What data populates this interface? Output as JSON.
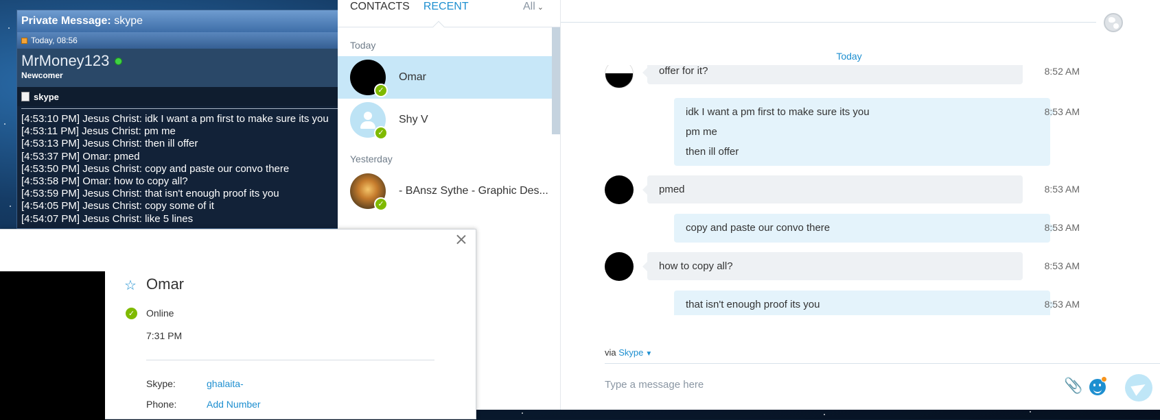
{
  "pm": {
    "title_prefix": "Private Message:",
    "title_subject": "skype",
    "date": "Today, 08:56",
    "username": "MrMoney123",
    "rank": "Newcomer",
    "subject": "skype",
    "lines": [
      "[4:53:10 PM] Jesus Christ: idk I want a pm first to make sure its you",
      "[4:53:11 PM] Jesus Christ: pm me",
      "[4:53:13 PM] Jesus Christ: then ill offer",
      "[4:53:37 PM] Omar: pmed",
      "[4:53:50 PM] Jesus Christ: copy and paste our convo there",
      "[4:53:58 PM] Omar: how to copy all?",
      "[4:53:59 PM] Jesus Christ: that isn't enough proof its you",
      "[4:54:05 PM] Jesus Christ: copy some of it",
      "[4:54:07 PM] Jesus Christ: like 5 lines"
    ]
  },
  "contacts": {
    "tab_contacts": "CONTACTS",
    "tab_recent": "RECENT",
    "filter": "All",
    "group_today": "Today",
    "group_yesterday": "Yesterday",
    "items": [
      {
        "name": "Omar",
        "status": "online"
      },
      {
        "name": "Shy V",
        "status": "online"
      },
      {
        "name": "- BAnsz Sythe - Graphic Des...",
        "status": "online"
      }
    ]
  },
  "chat": {
    "day_separator": "Today",
    "partial_message": "offer for it?",
    "partial_time": "8:52 AM",
    "messages": [
      {
        "dir": "out",
        "lines": [
          "idk I want a pm first to make sure its you",
          "pm me",
          "then ill offer"
        ],
        "time": "8:53 AM"
      },
      {
        "dir": "in",
        "lines": [
          "pmed"
        ],
        "time": "8:53 AM"
      },
      {
        "dir": "out",
        "lines": [
          "copy and paste our convo there"
        ],
        "time": "8:53 AM"
      },
      {
        "dir": "in",
        "lines": [
          "how to copy all?"
        ],
        "time": "8:53 AM"
      },
      {
        "dir": "out",
        "lines": [
          "that isn't enough proof its you"
        ],
        "time": "8:53 AM"
      }
    ],
    "via_label": "via",
    "via_link": "Skype",
    "compose_placeholder": "Type a message here"
  },
  "profile": {
    "name": "Omar",
    "status": "Online",
    "local_time": "7:31 PM",
    "skype_label": "Skype:",
    "skype_value": "ghalaita-",
    "phone_label": "Phone:",
    "phone_value": "Add Number"
  },
  "colors": {
    "accent": "#1e8fd0",
    "online": "#7fba00",
    "selected_row": "#c7e7f8",
    "outgoing_bubble": "#e4f3fb",
    "incoming_bubble": "#eef1f4"
  }
}
